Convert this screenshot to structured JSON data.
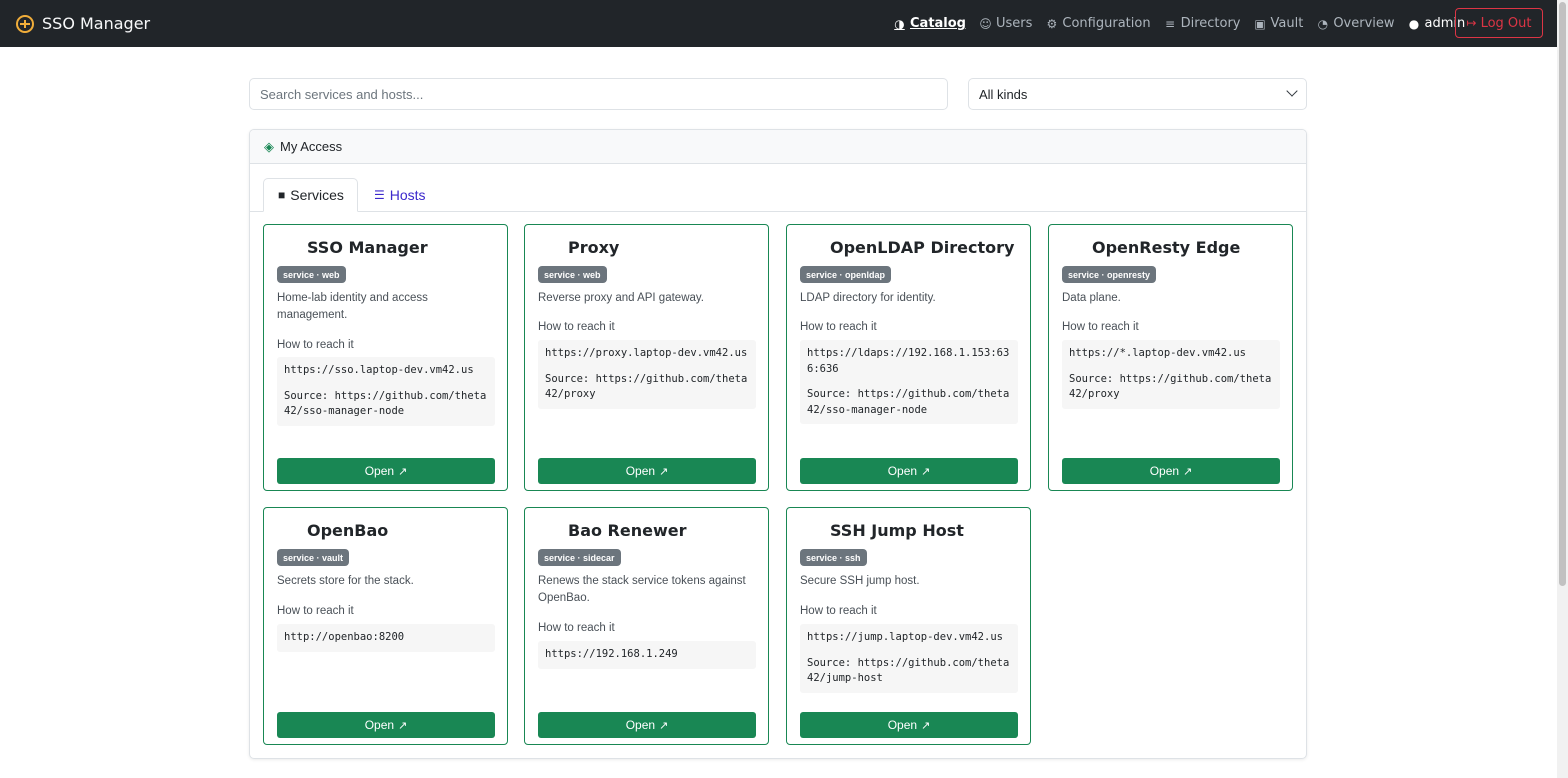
{
  "app": {
    "title": "SSO Manager"
  },
  "nav": {
    "items": [
      {
        "label": "Catalog",
        "icon": "compass-icon"
      },
      {
        "label": "Users",
        "icon": "users-icon"
      },
      {
        "label": "Configuration",
        "icon": "gears-icon"
      },
      {
        "label": "Directory",
        "icon": "server-icon"
      },
      {
        "label": "Vault",
        "icon": "vault-icon"
      },
      {
        "label": "Overview",
        "icon": "gauge-icon"
      }
    ],
    "user": "admin",
    "logout": "Log Out"
  },
  "search": {
    "placeholder": "Search services and hosts..."
  },
  "filter": {
    "selected": "All kinds"
  },
  "panel": {
    "title": "My Access"
  },
  "tabs": {
    "services": "Services",
    "hosts": "Hosts"
  },
  "reach_label": "How to reach it",
  "open_label": "Open",
  "services": [
    {
      "title": "SSO Manager",
      "badge": "service · web",
      "desc": "Home-lab identity and access management.",
      "url": "https://sso.laptop-dev.vm42.us",
      "source": "Source: https://github.com/theta42/sso-manager-node"
    },
    {
      "title": "Proxy",
      "badge": "service · web",
      "desc": "Reverse proxy and API gateway.",
      "url": "https://proxy.laptop-dev.vm42.us",
      "source": "Source: https://github.com/theta42/proxy"
    },
    {
      "title": "OpenLDAP Directory",
      "badge": "service · openldap",
      "desc": "LDAP directory for identity.",
      "url": "https://ldaps://192.168.1.153:636:636",
      "source": "Source: https://github.com/theta42/sso-manager-node"
    },
    {
      "title": "OpenResty Edge",
      "badge": "service · openresty",
      "desc": "Data plane.",
      "url": "https://*.laptop-dev.vm42.us",
      "source": "Source: https://github.com/theta42/proxy"
    },
    {
      "title": "OpenBao",
      "badge": "service · vault",
      "desc": "Secrets store for the stack.",
      "url": "http://openbao:8200",
      "source": ""
    },
    {
      "title": "Bao Renewer",
      "badge": "service · sidecar",
      "desc": "Renews the stack service tokens against OpenBao.",
      "url": "https://192.168.1.249",
      "source": ""
    },
    {
      "title": "SSH Jump Host",
      "badge": "service · ssh",
      "desc": "Secure SSH jump host.",
      "url": "https://jump.laptop-dev.vm42.us",
      "source": "Source: https://github.com/theta42/jump-host"
    }
  ]
}
